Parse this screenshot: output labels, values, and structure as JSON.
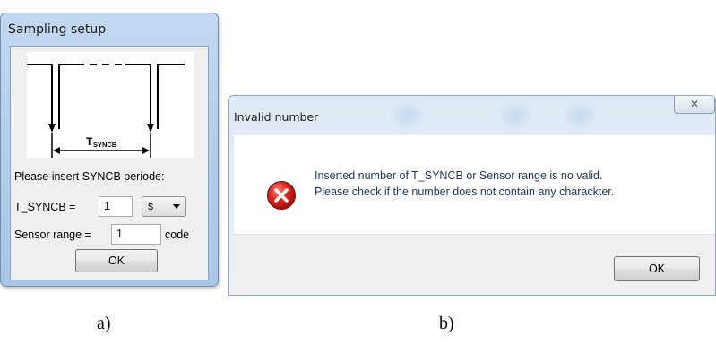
{
  "dialog_a": {
    "title": "Sampling setup",
    "timing_label": "T",
    "timing_label_sub": "SYNCB",
    "prompt": "Please insert SYNCB periode:",
    "tsyncb_label": "T_SYNCB =",
    "tsyncb_value": "1",
    "unit_selected": "s",
    "sensor_label": "Sensor range =",
    "sensor_value": "1",
    "sensor_unit": "code",
    "ok_label": "OK"
  },
  "dialog_b": {
    "title": "Invalid number",
    "close_glyph": "✕",
    "message_line1": "Inserted number of T_SYNCB or Sensor range is no valid.",
    "message_line2": "Please check if the number does not contain any charackter.",
    "ok_label": "OK"
  },
  "captions": {
    "a": "a)",
    "b": "b)"
  },
  "colors": {
    "error_red": "#d8231f",
    "window_frame": "#b9d1ea",
    "message_text": "#1e395b"
  }
}
